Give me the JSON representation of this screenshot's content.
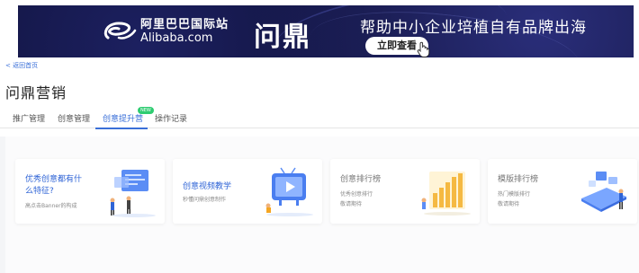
{
  "banner": {
    "logo_cn": "阿里巴巴国际站",
    "logo_en": "Alibaba.com",
    "brand": "问鼎",
    "slogan": "帮助中小企业培植自有品牌出海",
    "cta_label": "立即查看"
  },
  "nav": {
    "back_label": "< 返回首页"
  },
  "page": {
    "title": "问鼎营销"
  },
  "tabs": [
    {
      "label": "推广管理",
      "active": false
    },
    {
      "label": "创意管理",
      "active": false
    },
    {
      "label": "创意提升营",
      "active": true,
      "badge": "NEW"
    },
    {
      "label": "操作记录",
      "active": false
    }
  ],
  "cards": [
    {
      "title_line1": "优秀创意都有什",
      "title_line2": "么特征?",
      "subtitle": "高点击Banner的构成",
      "icon": "presentation-illustration-icon"
    },
    {
      "title_line1": "创意视频教学",
      "subtitle": "秒懂问鼎创意制作",
      "icon": "video-tv-illustration-icon"
    },
    {
      "title_line1": "创意排行榜",
      "subtitle_line1": "优秀创意排行",
      "subtitle_line2": "敬请期待",
      "icon": "bar-chart-illustration-icon"
    },
    {
      "title_line1": "模版排行榜",
      "subtitle_line1": "热门模版排行",
      "subtitle_line2": "敬请期待",
      "icon": "phone-template-illustration-icon"
    }
  ],
  "colors": {
    "accent": "#3a6fd8",
    "banner_bg": "#10123a",
    "badge_green": "#2ecc71"
  }
}
